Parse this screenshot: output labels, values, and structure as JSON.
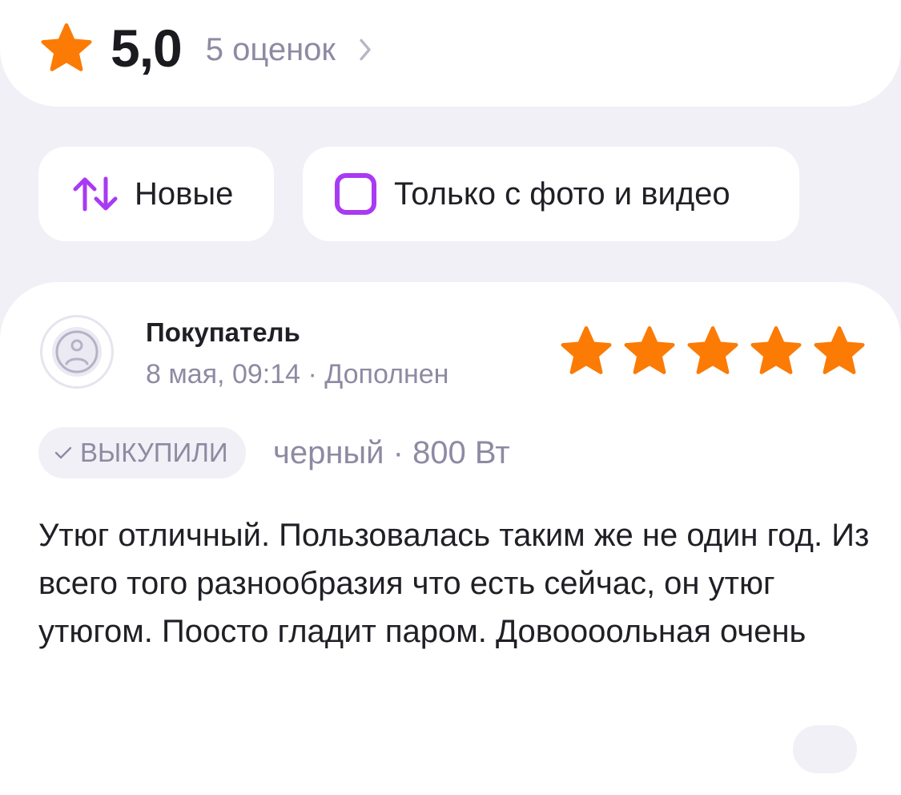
{
  "rating": {
    "icon": "star-icon",
    "star_color": "#fb7b05",
    "value": "5,0",
    "count_label": "5 оценок",
    "chevron_icon": "chevron-right-icon"
  },
  "filters": {
    "sort": {
      "icon": "sort-arrows-icon",
      "label": "Новые"
    },
    "photo_filter": {
      "icon": "checkbox-icon",
      "label": "Только с фото и видео",
      "checked": false
    },
    "accent_color": "#a93af3"
  },
  "review": {
    "avatar_icon": "sad-face-avatar-icon",
    "author": "Покупатель",
    "meta": "8 мая, 09:14 · Дополнен",
    "stars": 5,
    "max_stars": 5,
    "badge": {
      "icon": "check-icon",
      "label": "ВЫКУПИЛИ"
    },
    "variant": "черный · 800 Вт",
    "text": "Утюг отличный. Пользовалась таким же не один год. Из всего того разнообразия что есть сейчас, он утюг утюгом. Поосто гладит паром. Довоооольная очень"
  }
}
